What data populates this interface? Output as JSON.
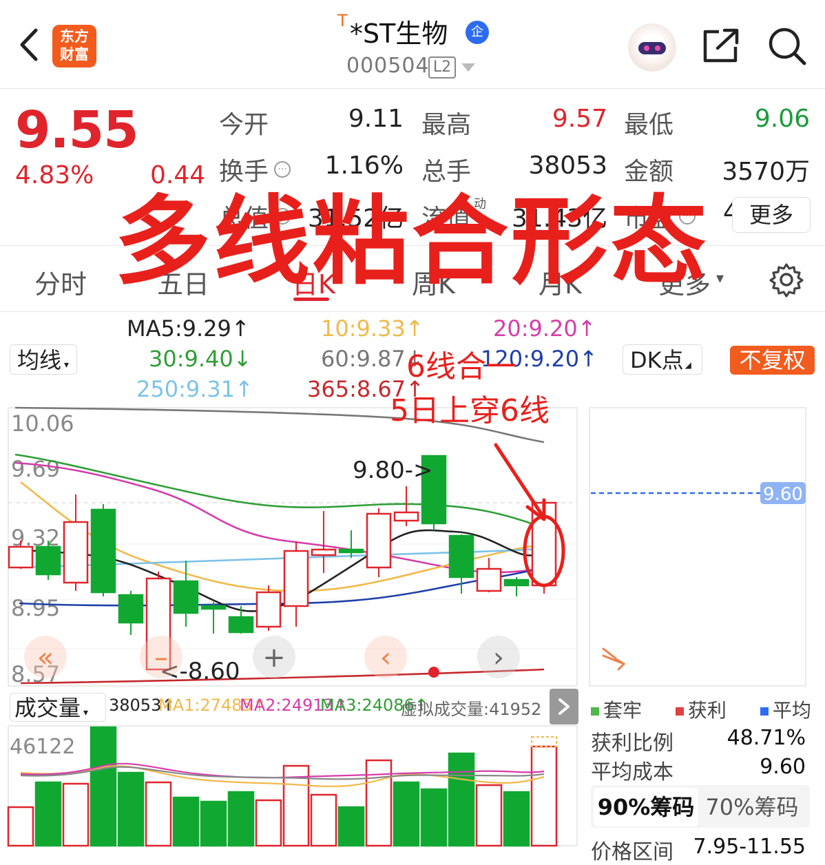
{
  "header": {
    "logo_line1": "东方",
    "logo_line2": "财富",
    "title_prefix": "T",
    "title": "*ST生物",
    "badge": "企",
    "code": "000504",
    "level": "L2"
  },
  "quote": {
    "price": "9.55",
    "change_pct": "4.83%",
    "change": "0.44",
    "rows": [
      [
        {
          "label": "今开",
          "value": "9.11",
          "color": "#222222"
        },
        {
          "label": "最高",
          "value": "9.57",
          "color": "#e0242c"
        },
        {
          "label": "最低",
          "value": "9.06",
          "color": "#1a9a3a"
        }
      ],
      [
        {
          "label": "换手",
          "value": "1.16%",
          "color": "#222222"
        },
        {
          "label": "总手",
          "value": "38053",
          "color": "#222222"
        },
        {
          "label": "金额",
          "value": "3570万",
          "color": "#222222"
        }
      ],
      [
        {
          "label": "总值",
          "value": "31.52亿",
          "color": "#222222"
        },
        {
          "label": "流值",
          "value": "31.43亿",
          "color": "#222222"
        },
        {
          "label": "市盈",
          "value": "451.77",
          "color": "#222222"
        }
      ]
    ],
    "pe_superscript": "动",
    "more": "更多"
  },
  "overlay_title": "多线粘合形态",
  "tabs": [
    "分时",
    "五日",
    "日K",
    "周K",
    "月K",
    "更多"
  ],
  "active_tab": "日K",
  "ma": {
    "selector": "均线",
    "ma5": "MA5:9.29↑",
    "ma10": "10:9.33↑",
    "ma20": "20:9.20↑",
    "ma30": "30:9.40↓",
    "ma60": "60:9.87↓",
    "ma120": "120:9.20↑",
    "ma250": "250:9.31↑",
    "ma365": "365:8.67↑",
    "dk": "DK点",
    "adjust": "不复权"
  },
  "annotations": {
    "line1": "6线合一",
    "line2": "5日上穿6线"
  },
  "chart": {
    "y_labels": [
      "10.06",
      "9.69",
      "9.32",
      "8.95",
      "8.57"
    ],
    "high_label": "9.80->",
    "low_label": "<-8.60",
    "chip_price": "9.60",
    "colors": {
      "up": "#e0242c",
      "down": "#11a832",
      "ma5": "#222222",
      "ma10": "#f0b94a",
      "ma20": "#d63cab",
      "ma30": "#2f9e36",
      "ma60": "#777777",
      "ma120": "#1f3fa8",
      "ma250": "#7cc3e8",
      "ma365": "#c6282c"
    }
  },
  "volume": {
    "selector": "成交量",
    "current": "38053↑",
    "ma1": "MA1:27485↑",
    "ma2": "MA2:24913↑",
    "ma3": "MA3:24086↑",
    "virtual": "虚拟成交量:41952",
    "y_label": "46122"
  },
  "chips": {
    "legend": [
      "套牢",
      "获利",
      "平均"
    ],
    "profit_ratio_label": "获利比例",
    "profit_ratio": "48.71%",
    "avg_cost_label": "平均成本",
    "avg_cost": "9.60",
    "tab90": "90%筹码",
    "tab70": "70%筹码",
    "range_label": "价格区间",
    "range_value": "7.95-11.55"
  }
}
